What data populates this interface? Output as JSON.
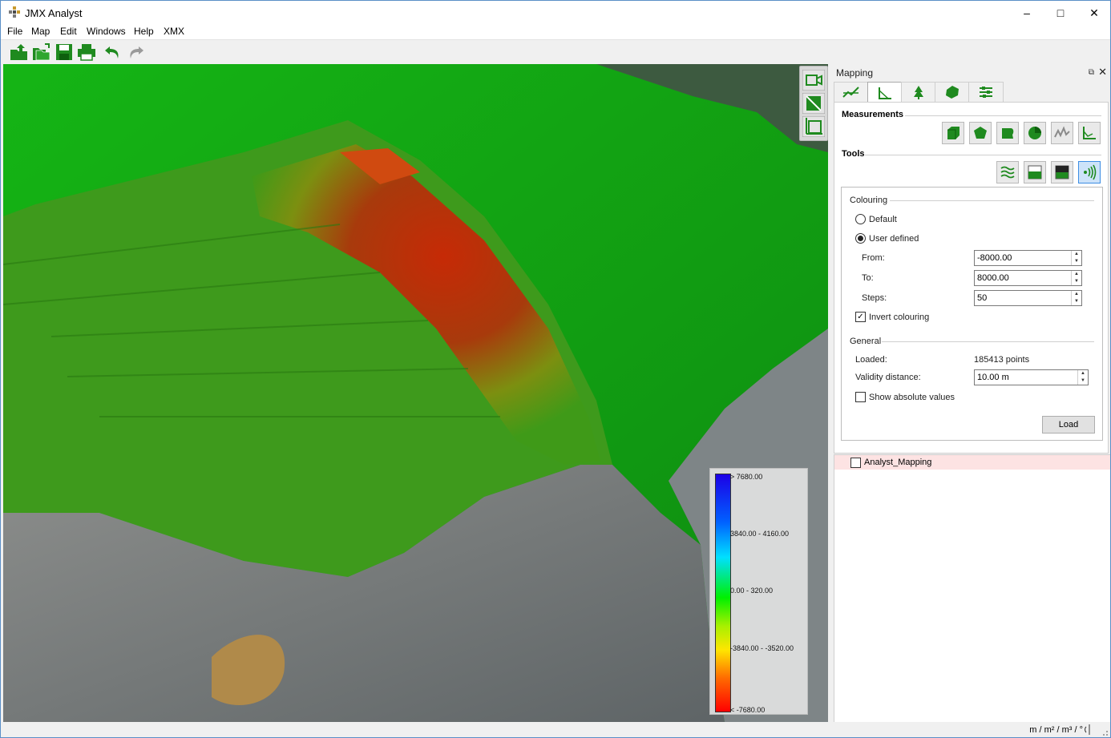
{
  "app": {
    "title": "JMX Analyst"
  },
  "window_controls": {
    "minimize": "–",
    "maximize": "□",
    "close": "✕"
  },
  "menu": {
    "items": [
      "File",
      "Map",
      "Edit",
      "Windows",
      "Help",
      "XMX"
    ]
  },
  "toolbar": {
    "buttons": [
      "open-icon",
      "open-folder-icon",
      "save-icon",
      "print-icon",
      "undo-icon",
      "redo-icon"
    ]
  },
  "map": {
    "tools": [
      "camera-icon",
      "diagonal-icon",
      "frame-icon"
    ],
    "legend": {
      "labels": [
        "> 7680.00",
        "3840.00 - 4160.00",
        "0.00 - 320.00",
        "-3840.00 - -3520.00",
        "< -7680.00"
      ]
    }
  },
  "dock": {
    "title": "Mapping",
    "tabs": [
      "profile-icon",
      "angle-icon",
      "tree-icon",
      "solid-icon",
      "settings-sliders-icon"
    ],
    "measurements": {
      "title": "Measurements",
      "buttons": [
        "volume-icon",
        "polygon-area-icon",
        "surface-area-icon",
        "pie-icon",
        "profile-line-icon",
        "angle-icon"
      ]
    },
    "tools": {
      "title": "Tools",
      "buttons": [
        "contour-icon",
        "layer-fill-icon",
        "layer-dark-icon",
        "distance-icon"
      ]
    },
    "colouring": {
      "title": "Colouring",
      "default_label": "Default",
      "user_defined_label": "User defined",
      "from_label": "From:",
      "from_value": "-8000.00",
      "to_label": "To:",
      "to_value": "8000.00",
      "steps_label": "Steps:",
      "steps_value": "50",
      "invert_label": "Invert colouring",
      "invert_checked": "✓"
    },
    "general": {
      "title": "General",
      "loaded_label": "Loaded:",
      "loaded_value": "185413 points",
      "validity_label": "Validity distance:",
      "validity_value": "10.00 m",
      "absolute_label": "Show absolute values"
    },
    "load_button": "Load"
  },
  "layers": {
    "items": [
      "Analyst_Mapping"
    ]
  },
  "statusbar": {
    "units": "m / m² / m³ / °"
  },
  "colors": {
    "accent": "#1e8e1e",
    "selection": "#fde3e3"
  }
}
